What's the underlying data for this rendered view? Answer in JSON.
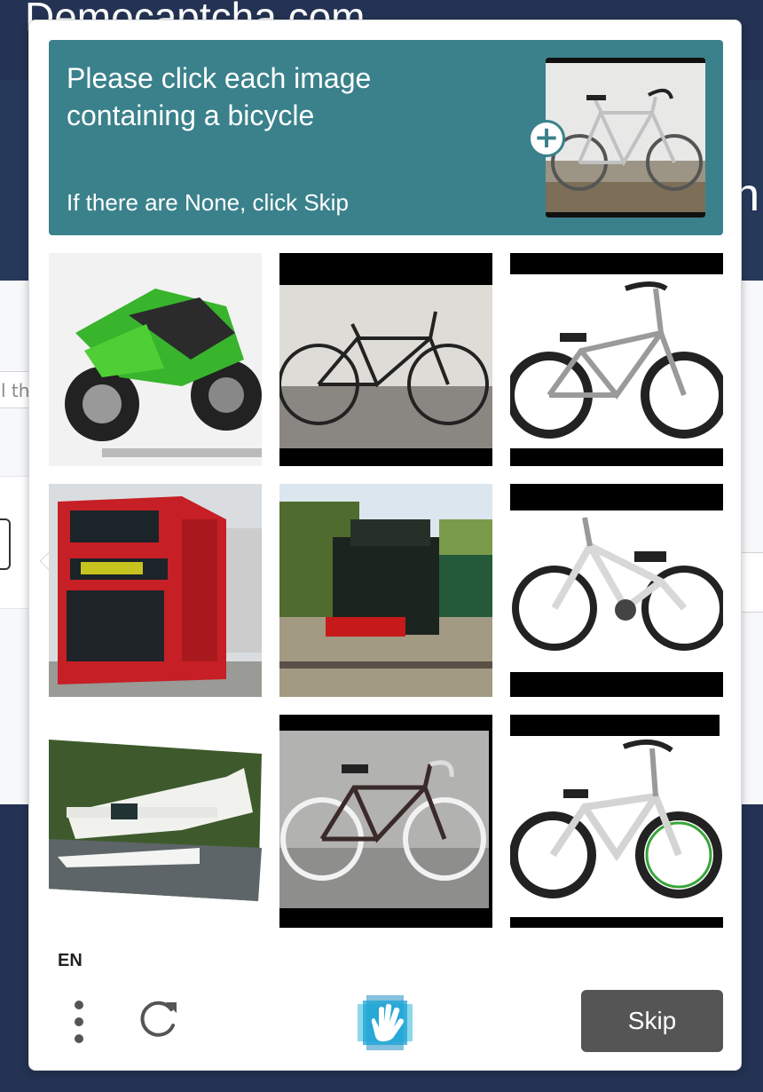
{
  "background": {
    "site_title": "Democaptcha.com",
    "band_letter": "n",
    "input_fragment": "l th"
  },
  "captcha": {
    "prompt": {
      "title": "Please click each image containing a bicycle",
      "subtitle": "If there are None, click Skip",
      "example_image": "bicycle-example",
      "add_badge": "+"
    },
    "tiles": [
      {
        "subject": "green-motorcycle"
      },
      {
        "subject": "bicycle-racing"
      },
      {
        "subject": "bmx-bicycle"
      },
      {
        "subject": "red-double-decker-bus"
      },
      {
        "subject": "steam-locomotive"
      },
      {
        "subject": "white-kids-bicycle"
      },
      {
        "subject": "seaplane"
      },
      {
        "subject": "fixed-gear-bicycle"
      },
      {
        "subject": "white-bmx-bicycle-green-rims"
      }
    ],
    "footer": {
      "language": "EN",
      "menu_icon": "more-options-icon",
      "refresh_icon": "refresh-icon",
      "logo_icon": "hcaptcha-hand-logo",
      "skip_label": "Skip"
    }
  },
  "colors": {
    "page_bg": "#243353",
    "prompt_bg": "#3a818b",
    "skip_bg": "#555555"
  }
}
